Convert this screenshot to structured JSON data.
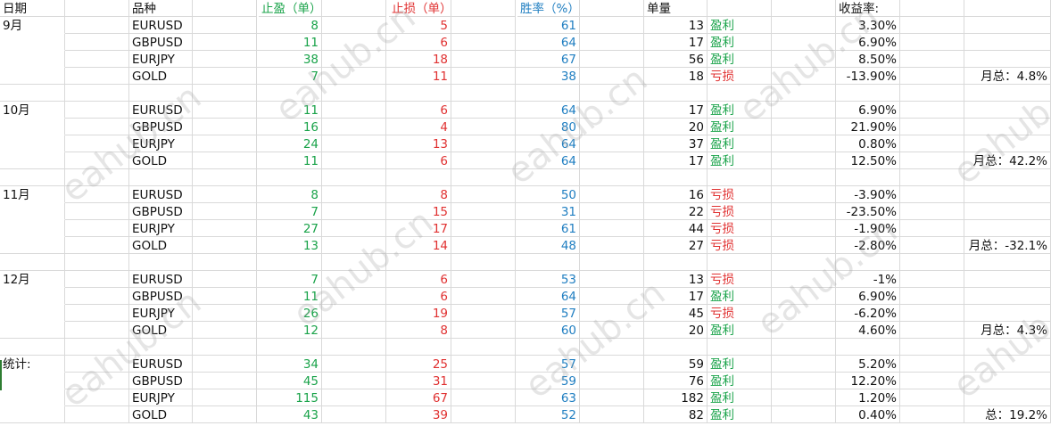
{
  "headers": {
    "date": "日期",
    "symbol": "品种",
    "tp": "止盈（单）",
    "sl": "止损（单）",
    "winrate": "胜率（%）",
    "orders": "单量",
    "yield": "收益率:"
  },
  "colors": {
    "green": "#1aa34a",
    "red": "#e03131",
    "blue": "#1f7ec1",
    "grid": "#d9d9d9"
  },
  "groups": [
    {
      "label": "9月",
      "rows": [
        {
          "symbol": "EURUSD",
          "tp": "8",
          "sl": "5",
          "winrate": "61",
          "orders": "13",
          "status": "盈利",
          "yield": "3.30%"
        },
        {
          "symbol": "GBPUSD",
          "tp": "11",
          "sl": "6",
          "winrate": "64",
          "orders": "17",
          "status": "盈利",
          "yield": "6.90%"
        },
        {
          "symbol": "EURJPY",
          "tp": "38",
          "sl": "18",
          "winrate": "67",
          "orders": "56",
          "status": "盈利",
          "yield": "8.50%"
        },
        {
          "symbol": "GOLD",
          "tp": "7",
          "sl": "11",
          "winrate": "38",
          "orders": "18",
          "status": "亏损",
          "yield": "-13.90%"
        }
      ],
      "summary": "月总：4.8%"
    },
    {
      "label": "10月",
      "rows": [
        {
          "symbol": "EURUSD",
          "tp": "11",
          "sl": "6",
          "winrate": "64",
          "orders": "17",
          "status": "盈利",
          "yield": "6.90%"
        },
        {
          "symbol": "GBPUSD",
          "tp": "16",
          "sl": "4",
          "winrate": "80",
          "orders": "20",
          "status": "盈利",
          "yield": "21.90%"
        },
        {
          "symbol": "EURJPY",
          "tp": "24",
          "sl": "13",
          "winrate": "64",
          "orders": "37",
          "status": "盈利",
          "yield": "0.80%"
        },
        {
          "symbol": "GOLD",
          "tp": "11",
          "sl": "6",
          "winrate": "64",
          "orders": "17",
          "status": "盈利",
          "yield": "12.50%"
        }
      ],
      "summary": "月总：42.2%"
    },
    {
      "label": "11月",
      "rows": [
        {
          "symbol": "EURUSD",
          "tp": "8",
          "sl": "8",
          "winrate": "50",
          "orders": "16",
          "status": "亏损",
          "yield": "-3.90%"
        },
        {
          "symbol": "GBPUSD",
          "tp": "7",
          "sl": "15",
          "winrate": "31",
          "orders": "22",
          "status": "亏损",
          "yield": "-23.50%"
        },
        {
          "symbol": "EURJPY",
          "tp": "27",
          "sl": "17",
          "winrate": "61",
          "orders": "44",
          "status": "亏损",
          "yield": "-1.90%"
        },
        {
          "symbol": "GOLD",
          "tp": "13",
          "sl": "14",
          "winrate": "48",
          "orders": "27",
          "status": "亏损",
          "yield": "-2.80%"
        }
      ],
      "summary": "月总：-32.1%"
    },
    {
      "label": "12月",
      "rows": [
        {
          "symbol": "EURUSD",
          "tp": "7",
          "sl": "6",
          "winrate": "53",
          "orders": "13",
          "status": "亏损",
          "yield": "-1%"
        },
        {
          "symbol": "GBPUSD",
          "tp": "11",
          "sl": "6",
          "winrate": "64",
          "orders": "17",
          "status": "盈利",
          "yield": "6.90%"
        },
        {
          "symbol": "EURJPY",
          "tp": "26",
          "sl": "19",
          "winrate": "57",
          "orders": "45",
          "status": "亏损",
          "yield": "-6.20%"
        },
        {
          "symbol": "GOLD",
          "tp": "12",
          "sl": "8",
          "winrate": "60",
          "orders": "20",
          "status": "盈利",
          "yield": "4.60%"
        }
      ],
      "summary": "月总：4.3%"
    },
    {
      "label": "统计:",
      "rows": [
        {
          "symbol": "EURUSD",
          "tp": "34",
          "sl": "25",
          "winrate": "57",
          "orders": "59",
          "status": "盈利",
          "yield": "5.20%"
        },
        {
          "symbol": "GBPUSD",
          "tp": "45",
          "sl": "31",
          "winrate": "59",
          "orders": "76",
          "status": "盈利",
          "yield": "12.20%"
        },
        {
          "symbol": "EURJPY",
          "tp": "115",
          "sl": "67",
          "winrate": "63",
          "orders": "182",
          "status": "盈利",
          "yield": "1.20%"
        },
        {
          "symbol": "GOLD",
          "tp": "43",
          "sl": "39",
          "winrate": "52",
          "orders": "82",
          "status": "盈利",
          "yield": "0.40%"
        }
      ],
      "summary": "总：19.2%"
    }
  ],
  "watermark": "eahub.cn"
}
